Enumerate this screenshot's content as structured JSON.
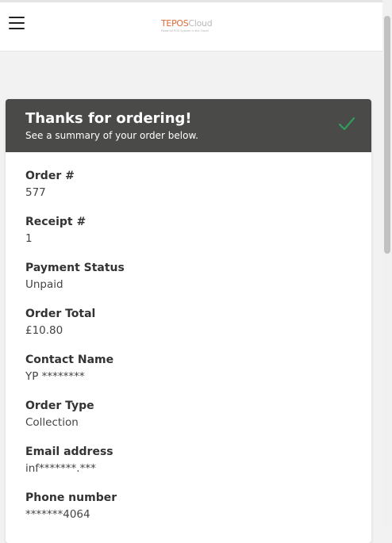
{
  "brand": {
    "name_part1": "TEPOS",
    "name_part2": "Cloud",
    "tagline": "Powerful POS System in the Cloud"
  },
  "confirmation": {
    "title": "Thanks for ordering!",
    "subtitle": "See a summary of your order below."
  },
  "fields": [
    {
      "label": "Order #",
      "value": "577"
    },
    {
      "label": "Receipt #",
      "value": "1"
    },
    {
      "label": "Payment Status",
      "value": "Unpaid"
    },
    {
      "label": "Order Total",
      "value": "£10.80"
    },
    {
      "label": "Contact Name",
      "value": "YP ********"
    },
    {
      "label": "Order Type",
      "value": "Collection"
    },
    {
      "label": "Email address",
      "value": "inf*******.***"
    },
    {
      "label": "Phone number",
      "value": "*******4064"
    }
  ],
  "colors": {
    "header_bar": "#4a4a49",
    "check": "#2e9e5b",
    "brand_accent": "#e06a3a"
  },
  "icons": {
    "menu": "hamburger-menu-icon",
    "check": "checkmark-icon"
  }
}
